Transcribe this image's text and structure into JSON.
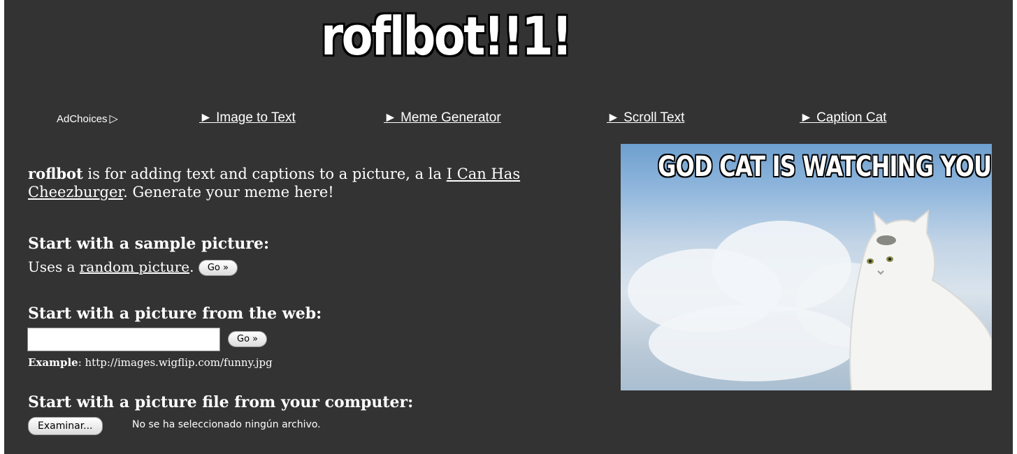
{
  "logo": {
    "text": "roflbot!!1!"
  },
  "nav": {
    "adchoices_label": "AdChoices",
    "items": [
      {
        "label": "► Image to Text"
      },
      {
        "label": "► Meme Generator"
      },
      {
        "label": "► Scroll Text"
      },
      {
        "label": "► Caption Cat"
      }
    ]
  },
  "intro": {
    "brand": "roflbot",
    "text_before_link": " is for adding text and captions to a picture, a la ",
    "link": "I Can Has Cheezburger",
    "text_after_link": ". Generate your meme here!"
  },
  "sample": {
    "heading": "Start with a sample picture:",
    "prefix": "Uses a ",
    "link": "random picture",
    "suffix": ".",
    "go_label": "Go »"
  },
  "web": {
    "heading": "Start with a picture from the web:",
    "input_value": "",
    "go_label": "Go »",
    "example_label": "Example",
    "example_text": ": http://images.wigflip.com/funny.jpg"
  },
  "file": {
    "heading": "Start with a picture file from your computer:",
    "button_label": "Examinar...",
    "status": "No se ha seleccionado ningún archivo."
  },
  "meme": {
    "caption": "GOD CAT IS WATCHING YOU"
  }
}
